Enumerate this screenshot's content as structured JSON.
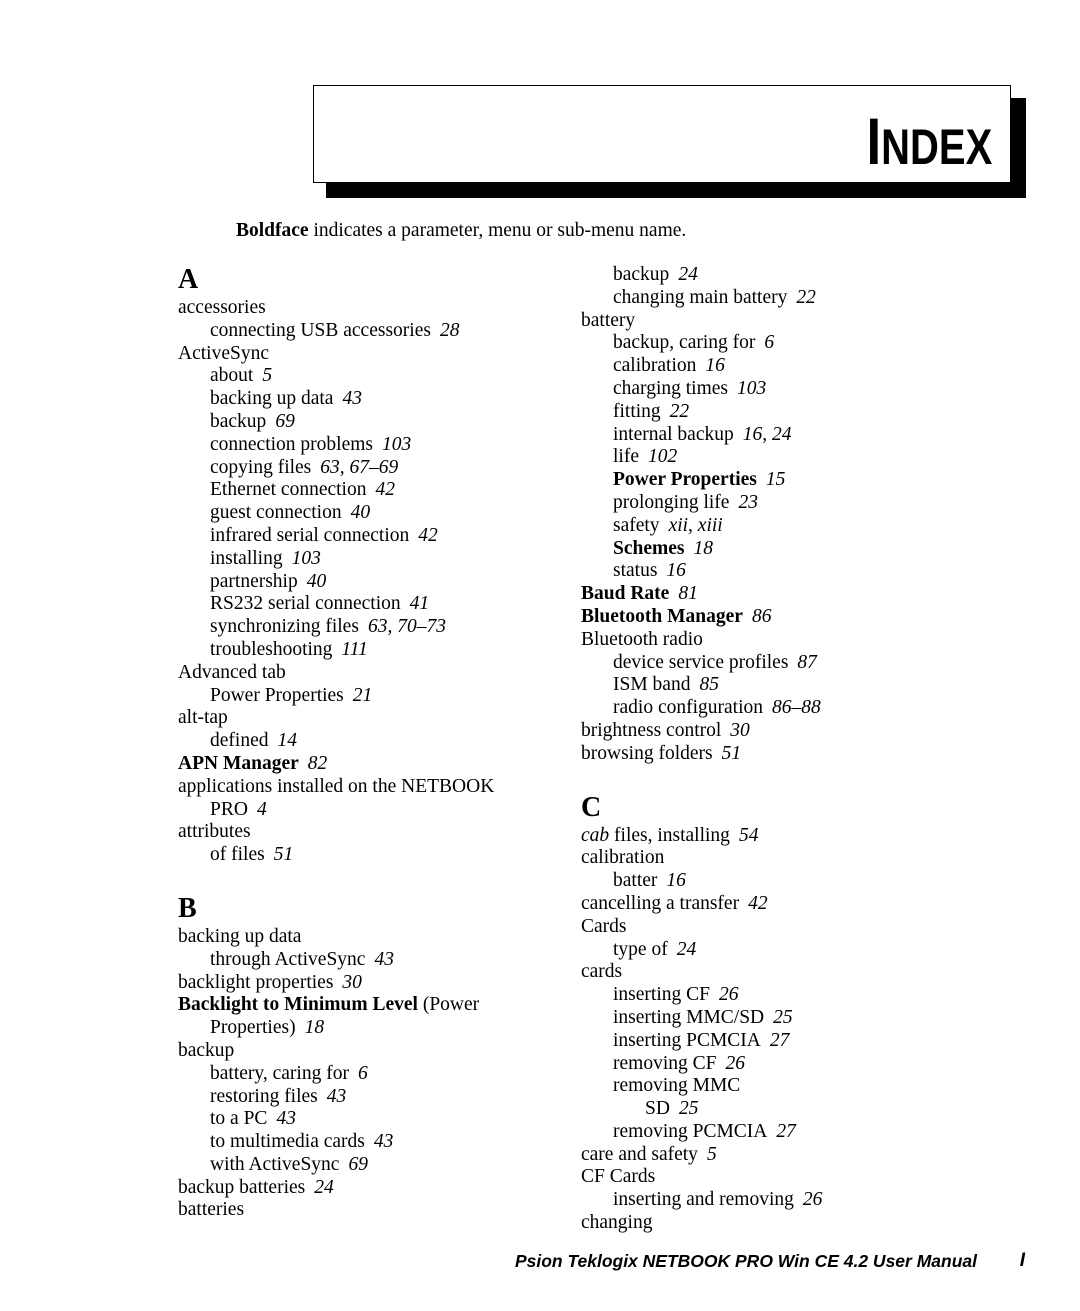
{
  "header": {
    "title_cap": "I",
    "title_rest": "NDEX"
  },
  "note": {
    "bold": "Boldface",
    "rest": " indicates a parameter, menu or sub-menu name."
  },
  "columns": {
    "left": [
      {
        "kind": "section",
        "label": "A"
      },
      {
        "kind": "entry",
        "level": 1,
        "text": "accessories",
        "page": ""
      },
      {
        "kind": "entry",
        "level": 2,
        "text": "connecting USB accessories",
        "page": "28"
      },
      {
        "kind": "entry",
        "level": 1,
        "text": "ActiveSync",
        "page": ""
      },
      {
        "kind": "entry",
        "level": 2,
        "text": "about",
        "page": "5"
      },
      {
        "kind": "entry",
        "level": 2,
        "text": "backing up data",
        "page": "43"
      },
      {
        "kind": "entry",
        "level": 2,
        "text": "backup",
        "page": "69"
      },
      {
        "kind": "entry",
        "level": 2,
        "text": "connection problems",
        "page": "103"
      },
      {
        "kind": "entry",
        "level": 2,
        "text": "copying files",
        "page": "63, 67–69"
      },
      {
        "kind": "entry",
        "level": 2,
        "text": "Ethernet connection",
        "page": "42"
      },
      {
        "kind": "entry",
        "level": 2,
        "text": "guest connection",
        "page": "40"
      },
      {
        "kind": "entry",
        "level": 2,
        "text": "infrared serial connection",
        "page": "42"
      },
      {
        "kind": "entry",
        "level": 2,
        "text": "installing",
        "page": "103"
      },
      {
        "kind": "entry",
        "level": 2,
        "text": "partnership",
        "page": "40"
      },
      {
        "kind": "entry",
        "level": 2,
        "text": "RS232 serial connection",
        "page": "41"
      },
      {
        "kind": "entry",
        "level": 2,
        "text": "synchronizing files",
        "page": "63, 70–73"
      },
      {
        "kind": "entry",
        "level": 2,
        "text": "troubleshooting",
        "page": "111"
      },
      {
        "kind": "entry",
        "level": 1,
        "text": "Advanced tab",
        "page": ""
      },
      {
        "kind": "entry",
        "level": 2,
        "text": "Power Properties",
        "page": "21"
      },
      {
        "kind": "entry",
        "level": 1,
        "text": "alt-tap",
        "page": ""
      },
      {
        "kind": "entry",
        "level": 2,
        "text": "defined",
        "page": "14"
      },
      {
        "kind": "entry",
        "level": 1,
        "bold_text": "APN Manager",
        "text": "",
        "page": "82"
      },
      {
        "kind": "entry",
        "level": 1,
        "text": "applications installed on the NETBOOK",
        "page": ""
      },
      {
        "kind": "entry",
        "level": 2,
        "text": "PRO",
        "page": "4"
      },
      {
        "kind": "entry",
        "level": 1,
        "text": "attributes",
        "page": ""
      },
      {
        "kind": "entry",
        "level": 2,
        "text": "of files",
        "page": "51"
      },
      {
        "kind": "section",
        "label": "B",
        "gap": true
      },
      {
        "kind": "entry",
        "level": 1,
        "text": "backing up data",
        "page": ""
      },
      {
        "kind": "entry",
        "level": 2,
        "text": "through ActiveSync",
        "page": "43"
      },
      {
        "kind": "entry",
        "level": 1,
        "text": "backlight properties",
        "page": "30"
      },
      {
        "kind": "entry",
        "level": 1,
        "bold_text": "Backlight to Minimum Level",
        "text": " (Power",
        "page": ""
      },
      {
        "kind": "entry",
        "level": 2,
        "text": "Properties)",
        "page": "18"
      },
      {
        "kind": "entry",
        "level": 1,
        "text": "backup",
        "page": ""
      },
      {
        "kind": "entry",
        "level": 2,
        "text": "battery, caring for",
        "page": "6"
      },
      {
        "kind": "entry",
        "level": 2,
        "text": "restoring files",
        "page": "43"
      },
      {
        "kind": "entry",
        "level": 2,
        "text": "to a PC",
        "page": "43"
      },
      {
        "kind": "entry",
        "level": 2,
        "text": "to multimedia cards",
        "page": "43"
      },
      {
        "kind": "entry",
        "level": 2,
        "text": "with ActiveSync",
        "page": "69"
      },
      {
        "kind": "entry",
        "level": 1,
        "text": "backup batteries",
        "page": "24"
      },
      {
        "kind": "entry",
        "level": 1,
        "text": "batteries",
        "page": ""
      }
    ],
    "right": [
      {
        "kind": "entry",
        "level": 2,
        "text": "backup",
        "page": "24"
      },
      {
        "kind": "entry",
        "level": 2,
        "text": "changing main battery",
        "page": "22"
      },
      {
        "kind": "entry",
        "level": 1,
        "text": "battery",
        "page": ""
      },
      {
        "kind": "entry",
        "level": 2,
        "text": "backup, caring for",
        "page": "6"
      },
      {
        "kind": "entry",
        "level": 2,
        "text": "calibration",
        "page": "16"
      },
      {
        "kind": "entry",
        "level": 2,
        "text": "charging times",
        "page": "103"
      },
      {
        "kind": "entry",
        "level": 2,
        "text": "fitting",
        "page": "22"
      },
      {
        "kind": "entry",
        "level": 2,
        "text": "internal backup",
        "page": "16, 24"
      },
      {
        "kind": "entry",
        "level": 2,
        "text": "life",
        "page": "102"
      },
      {
        "kind": "entry",
        "level": 2,
        "bold_text": "Power Properties",
        "text": "",
        "page": "15"
      },
      {
        "kind": "entry",
        "level": 2,
        "text": "prolonging life",
        "page": "23"
      },
      {
        "kind": "entry",
        "level": 2,
        "text": "safety",
        "page": "xii, xiii"
      },
      {
        "kind": "entry",
        "level": 2,
        "bold_text": "Schemes",
        "text": "",
        "page": "18"
      },
      {
        "kind": "entry",
        "level": 2,
        "text": "status",
        "page": "16"
      },
      {
        "kind": "entry",
        "level": 1,
        "bold_text": "Baud Rate",
        "text": "",
        "page": "81"
      },
      {
        "kind": "entry",
        "level": 1,
        "bold_text": "Bluetooth Manager",
        "text": "",
        "page": "86"
      },
      {
        "kind": "entry",
        "level": 1,
        "text": "Bluetooth radio",
        "page": ""
      },
      {
        "kind": "entry",
        "level": 2,
        "text": "device service profiles",
        "page": "87"
      },
      {
        "kind": "entry",
        "level": 2,
        "text": "ISM band",
        "page": "85"
      },
      {
        "kind": "entry",
        "level": 2,
        "text": "radio configuration",
        "page": "86–88"
      },
      {
        "kind": "entry",
        "level": 1,
        "text": "brightness control",
        "page": "30"
      },
      {
        "kind": "entry",
        "level": 1,
        "text": "browsing folders",
        "page": "51"
      },
      {
        "kind": "section",
        "label": "C",
        "gap": true
      },
      {
        "kind": "entry",
        "level": 1,
        "italic_text": "cab",
        "text": " files, installing",
        "page": "54"
      },
      {
        "kind": "entry",
        "level": 1,
        "text": "calibration",
        "page": ""
      },
      {
        "kind": "entry",
        "level": 2,
        "text": "batter",
        "page": "16"
      },
      {
        "kind": "entry",
        "level": 1,
        "text": "cancelling a transfer",
        "page": "42"
      },
      {
        "kind": "entry",
        "level": 1,
        "text": "Cards",
        "page": ""
      },
      {
        "kind": "entry",
        "level": 2,
        "text": "type of",
        "page": "24"
      },
      {
        "kind": "entry",
        "level": 1,
        "text": "cards",
        "page": ""
      },
      {
        "kind": "entry",
        "level": 2,
        "text": "inserting CF",
        "page": "26"
      },
      {
        "kind": "entry",
        "level": 2,
        "text": "inserting MMC/SD",
        "page": "25"
      },
      {
        "kind": "entry",
        "level": 2,
        "text": "inserting PCMCIA",
        "page": "27"
      },
      {
        "kind": "entry",
        "level": 2,
        "text": "removing CF",
        "page": "26"
      },
      {
        "kind": "entry",
        "level": 2,
        "text": "removing MMC",
        "page": ""
      },
      {
        "kind": "entry",
        "level": 3,
        "text": "SD",
        "page": "25"
      },
      {
        "kind": "entry",
        "level": 2,
        "text": "removing PCMCIA",
        "page": "27"
      },
      {
        "kind": "entry",
        "level": 1,
        "text": "care and safety",
        "page": "5"
      },
      {
        "kind": "entry",
        "level": 1,
        "text": "CF Cards",
        "page": ""
      },
      {
        "kind": "entry",
        "level": 2,
        "text": "inserting and removing",
        "page": "26"
      },
      {
        "kind": "entry",
        "level": 1,
        "text": "changing",
        "page": ""
      }
    ]
  },
  "footer": {
    "text": "Psion Teklogix NETBOOK PRO Win CE 4.2 User Manual",
    "page_number": "I"
  }
}
